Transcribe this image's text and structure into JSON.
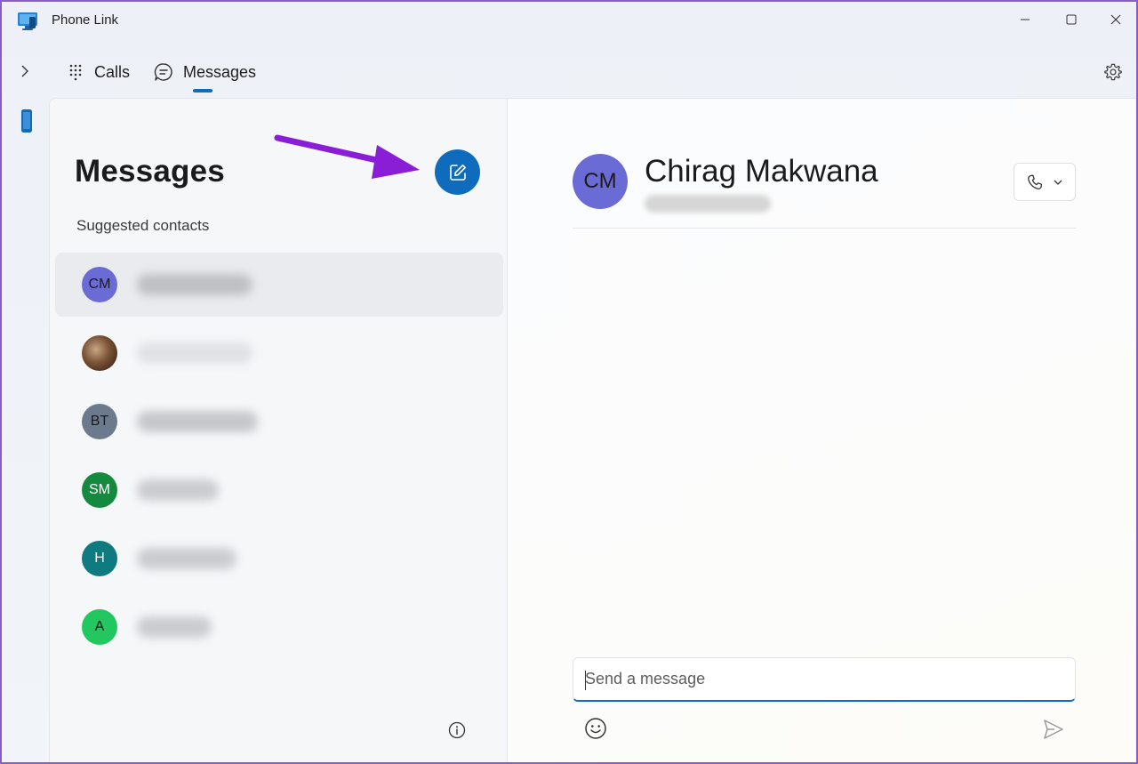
{
  "window": {
    "title": "Phone Link",
    "border_color": "#8a5cc7"
  },
  "nav": {
    "tabs": [
      {
        "label": "Calls",
        "icon": "dialpad-icon"
      },
      {
        "label": "Messages",
        "icon": "chat-bubble-icon",
        "selected": true
      }
    ],
    "accent": "#0f6cbd"
  },
  "messages_panel": {
    "heading": "Messages",
    "suggested_label": "Suggested contacts",
    "compose_icon": "compose-icon",
    "compose_color": "#0f6cbd",
    "annotation_arrow_color": "#8a1ed6",
    "contacts": [
      {
        "initials": "CM",
        "avatar_color": "#6b6bd6",
        "text_color": "#1b1b1b",
        "selected": true,
        "name_redacted": true
      },
      {
        "initials": "",
        "avatar_color": "#5a4030",
        "photo": true,
        "name_redacted": true
      },
      {
        "initials": "BT",
        "avatar_color": "#6b7a8d",
        "text_color": "#1b1b1b",
        "name_redacted": true
      },
      {
        "initials": "SM",
        "avatar_color": "#148a3f",
        "text_color": "#ffffff",
        "name_redacted": true
      },
      {
        "initials": "H",
        "avatar_color": "#0f7a80",
        "text_color": "#ffffff",
        "name_redacted": true
      },
      {
        "initials": "A",
        "avatar_color": "#22c760",
        "text_color": "#1b1b1b",
        "name_redacted": true
      }
    ]
  },
  "chat": {
    "contact_initials": "CM",
    "contact_name": "Chirag Makwana",
    "avatar_color": "#6b6bd6",
    "input_placeholder": "Send a message"
  }
}
